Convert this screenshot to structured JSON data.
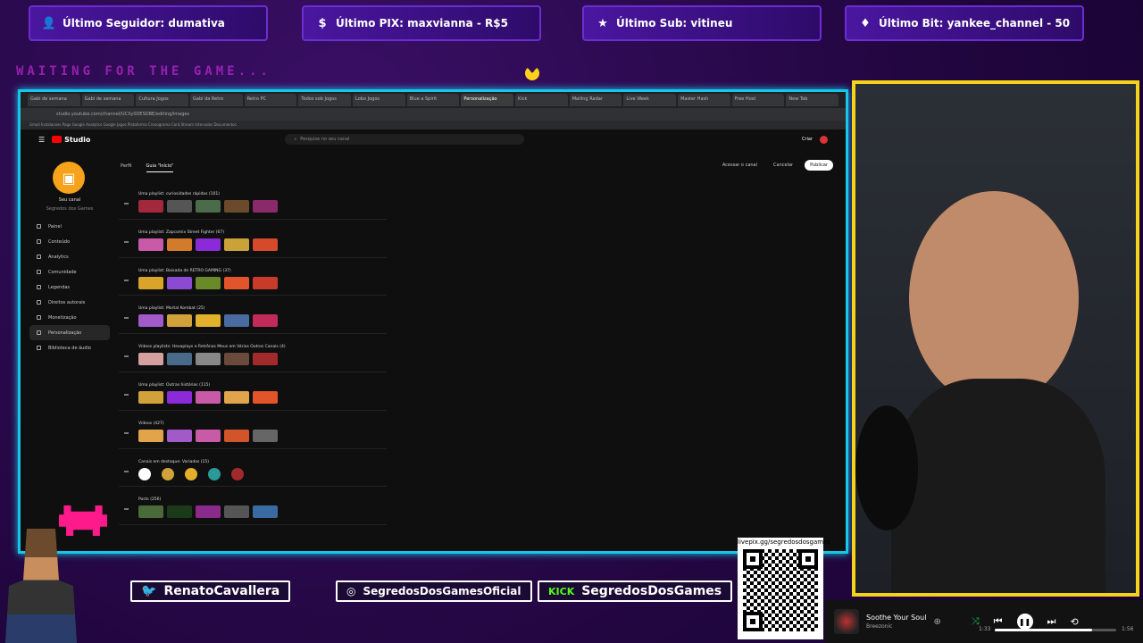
{
  "colors": {
    "accent_purple": "#6a2ecf",
    "cyan_frame": "#17c6e8",
    "yellow_frame": "#f5d21c",
    "waiting_pink": "#c22ad8"
  },
  "stats": [
    {
      "icon": "user-icon",
      "glyph": "👤",
      "label": "Último Seguidor: dumativa"
    },
    {
      "icon": "dollar-icon",
      "glyph": "$",
      "label": "Último PIX: maxvianna - R$5"
    },
    {
      "icon": "star-icon",
      "glyph": "★",
      "label": "Último Sub: vitineu"
    },
    {
      "icon": "diamond-icon",
      "glyph": "♦",
      "label": "Último Bit: yankee_channel - 50"
    }
  ],
  "waiting_text": "WAITING FOR THE GAME...",
  "browser": {
    "tabs": [
      "Gabi de semana",
      "Gabi de semana",
      "Cultura Jogos",
      "Gabi da Retro",
      "Retro PC",
      "Todos sob Jogos",
      "Lobo Jogos",
      "Blue a Spirit",
      "Personalização",
      "Kick",
      "Mailing Radar",
      "Live Week",
      "Master Hash",
      "Free Host",
      "New Tab"
    ],
    "active_tab": 8,
    "url": "studio.youtube.com/channel/UCXy0DESDBE/editing/images",
    "bookmarks": "Gmail  Instalacoes  Pago  Google Analytics  Google Jogos  Plataforma  Cronograma  Cont.Stream  Intervalos  Documentos"
  },
  "studio": {
    "logo": "Studio",
    "search_placeholder": "Pesquise no seu canal",
    "create_label": "Criar",
    "channel_name": "Seu canal",
    "channel_sub": "Segredos dos Games",
    "nav": [
      {
        "icon": "dashboard-icon",
        "label": "Painel"
      },
      {
        "icon": "content-icon",
        "label": "Conteúdo"
      },
      {
        "icon": "analytics-icon",
        "label": "Analytics"
      },
      {
        "icon": "community-icon",
        "label": "Comunidade"
      },
      {
        "icon": "subtitles-icon",
        "label": "Legendas"
      },
      {
        "icon": "copyright-icon",
        "label": "Direitos autorais"
      },
      {
        "icon": "money-icon",
        "label": "Monetização"
      },
      {
        "icon": "brush-icon",
        "label": "Personalização"
      },
      {
        "icon": "audio-icon",
        "label": "Biblioteca de áudio"
      }
    ],
    "active_nav": 7,
    "tabs": [
      "Perfil",
      "Guia \"Início\""
    ],
    "actions": {
      "view": "Acessar o canal",
      "cancel": "Cancelar",
      "publish": "Publicar"
    },
    "sections": [
      {
        "title": "Uma playlist: curiosidades rápidas (101)",
        "thumbs": [
          "#a2283b",
          "#555",
          "#4b6b4b",
          "#6a4a2a",
          "#8a2a6a"
        ]
      },
      {
        "title": "Uma playlist: Zapcomix Street Fighter (67)",
        "thumbs": [
          "#c85aa8",
          "#d27b2a",
          "#8a2ad8",
          "#c9a23a",
          "#d44a2a"
        ]
      },
      {
        "title": "Uma playlist: Baixada de RETRO GAMING (37)",
        "thumbs": [
          "#d9a42a",
          "#8a4ad2",
          "#6a8a2a",
          "#e2542a",
          "#c83a2a"
        ]
      },
      {
        "title": "Uma playlist: Mortal Kombat (25)",
        "thumbs": [
          "#a25ac8",
          "#d2a23a",
          "#e2b02a",
          "#4a6aa2",
          "#c22a5a"
        ]
      },
      {
        "title": "Vídeos playlists: Hexaplays e Retrônos Meus em Vários Outros Canais (4)",
        "thumbs": [
          "#d4a0a0",
          "#4a6a8a",
          "#888",
          "#6a4a3a",
          "#a22a2a"
        ]
      },
      {
        "title": "Uma playlist: Outras histórias (115)",
        "thumbs": [
          "#d2a23a",
          "#8a2ad8",
          "#c85aa8",
          "#e2a44a",
          "#e2542a"
        ]
      },
      {
        "title": "Vídeos (427)",
        "thumbs": [
          "#e2a44a",
          "#a25ac8",
          "#c85aa8",
          "#d2542a",
          "#666"
        ]
      },
      {
        "title": "Canais em destaque: Variados (15)",
        "circles": [
          "#fff",
          "#d2a23a",
          "#e2b02a",
          "#2a9a9a",
          "#a22a2a"
        ]
      },
      {
        "title": "Posts (256)",
        "thumbs": [
          "#4a6a3a",
          "#1a3a1a",
          "#8a2a8a",
          "#555",
          "#3a6aa2"
        ]
      }
    ]
  },
  "socials": [
    {
      "icon": "twitter-icon",
      "glyph": "🐦",
      "label": "RenatoCavallera"
    },
    {
      "icon": "instagram-icon",
      "glyph": "◎",
      "label": "SegredosDosGamesOficial"
    },
    {
      "icon": "kick-icon",
      "glyph": "KICK",
      "label": "SegredosDosGames"
    }
  ],
  "qr_url": "livepix.gg/segredosdosgames",
  "player": {
    "song": "Soothe Your Soul",
    "artist": "Breezonic",
    "elapsed": "1:33",
    "duration": "1:56",
    "progress": 0.8
  }
}
